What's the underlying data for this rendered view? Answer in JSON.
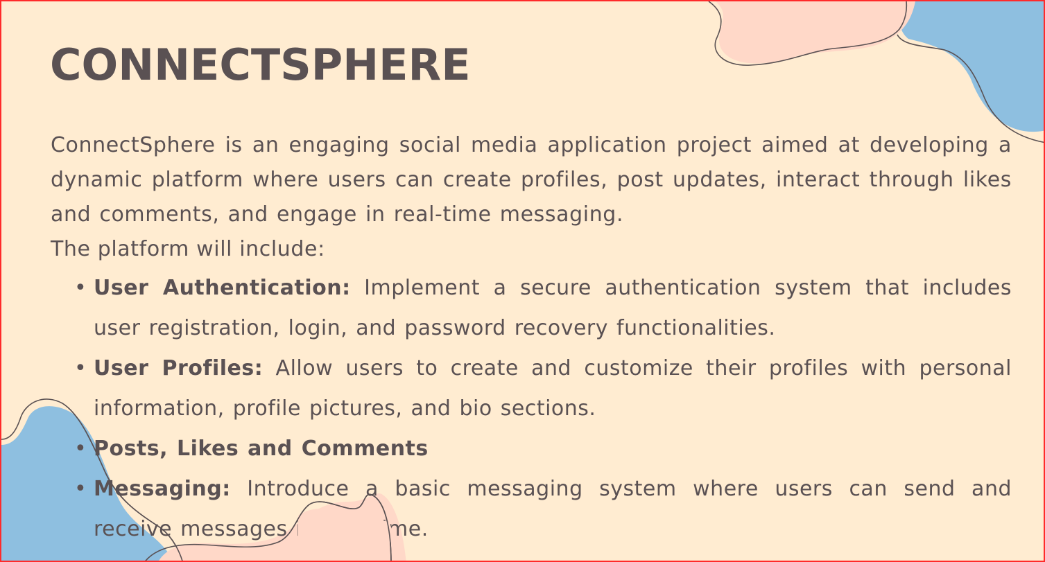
{
  "title": "CONNECTSPHERE",
  "intro": "ConnectSphere is an engaging social media application project aimed at developing a dynamic platform where users can create profiles, post updates, interact through likes and comments, and engage in real-time messaging.",
  "lead": "The platform will include:",
  "features": [
    {
      "name": "User Authentication:",
      "text": " Implement a secure authentication system that includes user registration, login, and password recovery functionalities."
    },
    {
      "name": "User Profiles:",
      "text": " Allow users to create and customize their profiles with personal information, profile pictures, and bio sections."
    },
    {
      "name": "Posts, Likes and Comments",
      "text": ""
    },
    {
      "name": "Messaging:",
      "text": " Introduce a basic messaging system where users can send and receive messages in real time."
    }
  ],
  "colors": {
    "background": "#ffecd1",
    "text": "#5a5153",
    "blob_blue": "#8ebfe0",
    "blob_pink": "#ffd8c8",
    "frame": "#ff2a2a"
  }
}
